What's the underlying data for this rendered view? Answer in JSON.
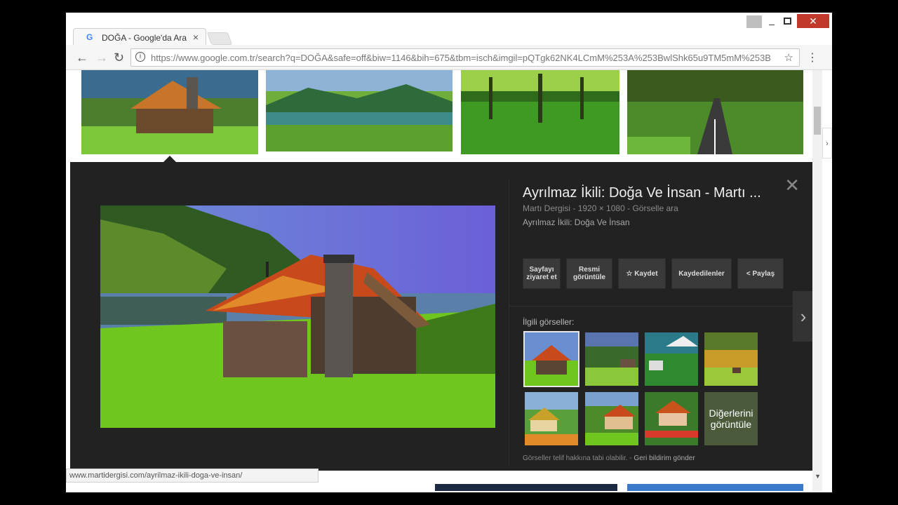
{
  "browser": {
    "tab_title": "DOĞA - Google'da Ara",
    "tab_icon": "G",
    "tab_close": "×",
    "url_host": "https://www.google.com.tr",
    "url_rest": "/search?q=DOĞA&safe=off&biw=1146&bih=675&tbm=isch&imgil=pQTgk62NK4LCmM%253A%253BwlShk65u9TM5mM%253B",
    "back": "←",
    "forward": "→",
    "reload": "↻",
    "info": "i",
    "star": "☆",
    "menu": "⋮",
    "minimize": "–",
    "close": "✕"
  },
  "panel": {
    "title": "Ayrılmaz İkili: Doğa Ve İnsan - Martı ...",
    "meta_source": "Martı Dergisi",
    "meta_sep": " - ",
    "meta_size": "1920 × 1080",
    "meta_search": "Görselle ara",
    "subtitle": "Ayrılmaz İkili: Doğa Ve İnsan",
    "actions": [
      {
        "label": "Sayfayı ziyaret et"
      },
      {
        "label": "Resmi görüntüle"
      },
      {
        "label": "☆ Kaydet"
      },
      {
        "label": "Kaydedilenler"
      },
      {
        "label": "< Paylaş"
      }
    ],
    "related_label": "İlgili görseller:",
    "more_label": "Diğerlerini görüntüle",
    "footnote": "Görseller telif hakkına tabi olabilir.",
    "footnote_sep": " - ",
    "feedback": "Geri bildirim gönder",
    "close": "✕",
    "next": "›"
  },
  "status_url": "www.martidergisi.com/ayrilmaz-ikili-doga-ve-insan/",
  "icons": {
    "scroll_down": "▼",
    "side_toggle": "›"
  }
}
